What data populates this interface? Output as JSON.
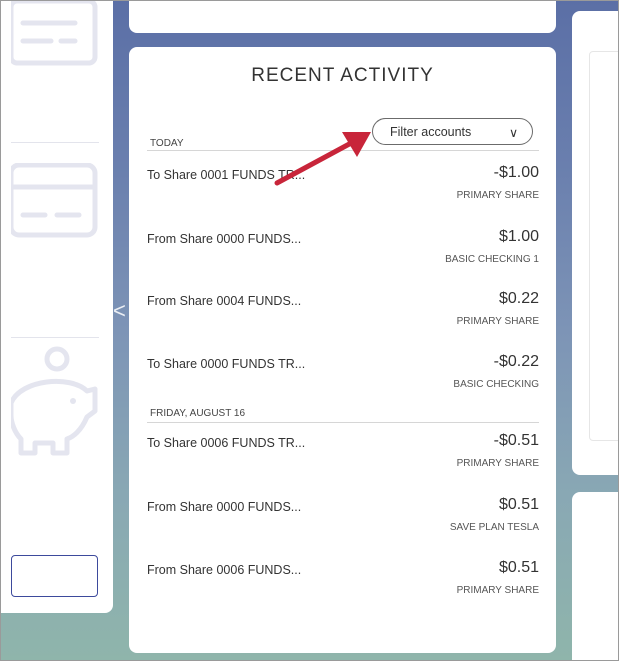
{
  "card": {
    "title": "RECENT ACTIVITY",
    "filter_label": "Filter accounts",
    "filter_chevron": "∨"
  },
  "sections": [
    {
      "label": "TODAY",
      "transactions": [
        {
          "description": "To Share 0001 FUNDS TR...",
          "amount": "-$1.00",
          "account": "PRIMARY SHARE"
        },
        {
          "description": "From Share 0000 FUNDS...",
          "amount": "$1.00",
          "account": "BASIC CHECKING 1"
        },
        {
          "description": "From Share 0004 FUNDS...",
          "amount": "$0.22",
          "account": "PRIMARY SHARE"
        },
        {
          "description": "To Share 0000 FUNDS TR...",
          "amount": "-$0.22",
          "account": "BASIC CHECKING"
        }
      ]
    },
    {
      "label": "FRIDAY, AUGUST 16",
      "transactions": [
        {
          "description": "To Share 0006 FUNDS TR...",
          "amount": "-$0.51",
          "account": "PRIMARY SHARE"
        },
        {
          "description": "From Share 0000 FUNDS...",
          "amount": "$0.51",
          "account": "SAVE PLAN TESLA"
        },
        {
          "description": "From Share 0006 FUNDS...",
          "amount": "$0.51",
          "account": "PRIMARY SHARE"
        }
      ]
    }
  ],
  "carousel": {
    "prev_glyph": "<"
  },
  "icons": {
    "sidebar": [
      "receipt-icon",
      "credit-card-icon",
      "piggy-bank-icon"
    ],
    "annotation": "red-arrow-pointer"
  },
  "colors": {
    "annotation_arrow": "#c8253a",
    "icon_stroke": "#e4e5ef",
    "input_border": "#3d4a9c"
  }
}
